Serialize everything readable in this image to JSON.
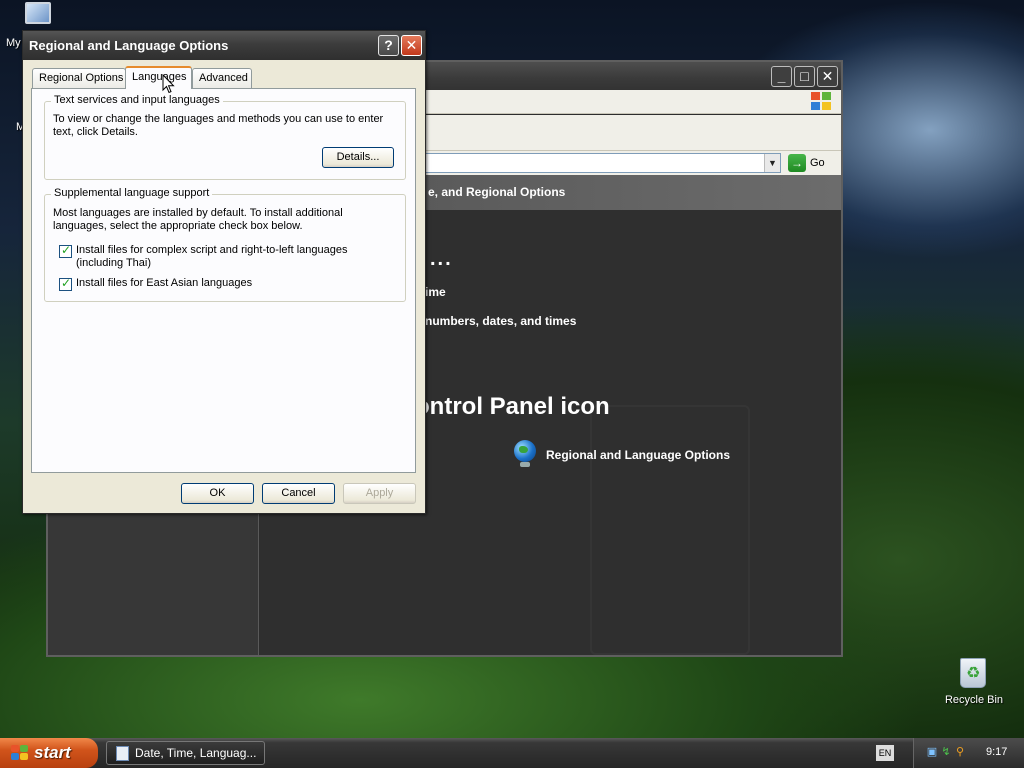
{
  "desktop": {
    "mycomputer_label_partial": "My",
    "mycomputer_second_partial": "M",
    "recycle_bin_label": "Recycle Bin"
  },
  "control_panel": {
    "header_text": "e, and Regional Options",
    "go_label": "Go",
    "dots": "...",
    "task_time": "ime",
    "task_numbers": "numbers, dates, and times",
    "pick_icon_heading": "ontrol Panel icon",
    "icon_label": "Regional and Language Options"
  },
  "dialog": {
    "title": "Regional and Language Options",
    "help_label": "?",
    "close_label": "✕",
    "tabs": [
      {
        "label": "Regional Options",
        "selected": false
      },
      {
        "label": "Languages",
        "selected": true
      },
      {
        "label": "Advanced",
        "selected": false
      }
    ],
    "text_services": {
      "legend": "Text services and input languages",
      "description": "To view or change the languages and methods you can use to enter text, click Details.",
      "details_button": "Details..."
    },
    "supplemental": {
      "legend": "Supplemental language support",
      "description": "Most languages are installed by default. To install additional languages, select the appropriate check box below.",
      "checkboxes": [
        {
          "label": "Install files for complex script and right-to-left languages (including Thai)",
          "checked": true
        },
        {
          "label": "Install files for East Asian languages",
          "checked": true
        }
      ]
    },
    "buttons": {
      "ok": "OK",
      "cancel": "Cancel",
      "apply": "Apply"
    }
  },
  "taskbar": {
    "start_label": "start",
    "task_button_label": "Date, Time, Languag...",
    "language_indicator": "EN",
    "clock": "9:17"
  },
  "colors": {
    "tab_accent": "#e68b2c",
    "start_button": "#d1541b",
    "checkmark": "#21a121"
  }
}
